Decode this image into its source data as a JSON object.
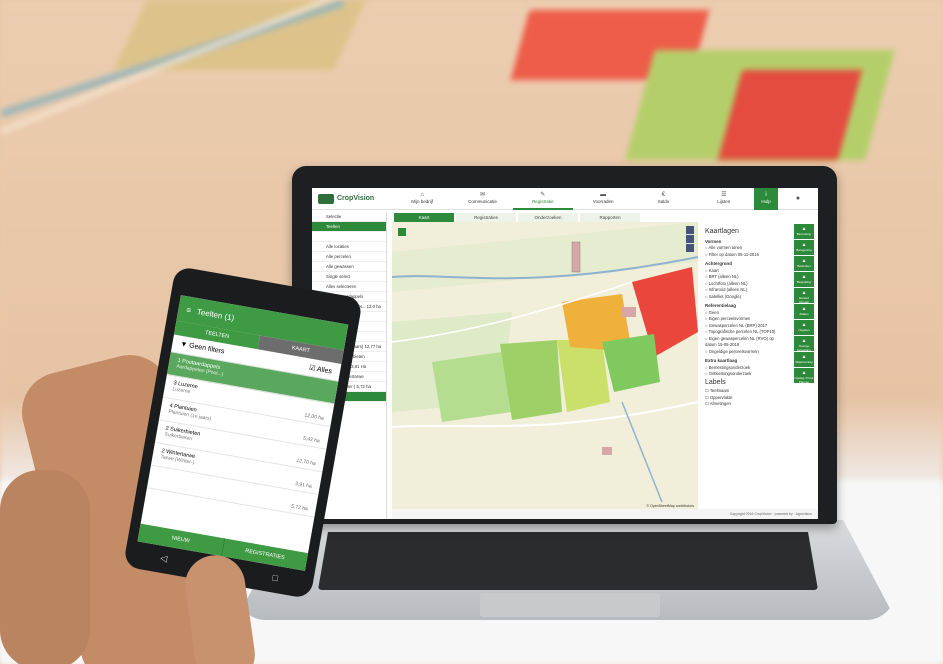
{
  "app": {
    "logo_text": "CropVision",
    "nav": [
      {
        "label": "Mijn bedrijf",
        "icon": "home-icon"
      },
      {
        "label": "Communicatie",
        "icon": "mail-icon"
      },
      {
        "label": "Registratie",
        "icon": "pencil-icon"
      },
      {
        "label": "Voorraden",
        "icon": "truck-icon"
      },
      {
        "label": "Saldo",
        "icon": "euro-icon"
      },
      {
        "label": "Lijsten",
        "icon": "list-icon"
      }
    ],
    "help_label": "Hulp",
    "sidebar": {
      "rows": [
        "Selectie",
        "Teelten",
        "",
        "Alle locaties",
        "Alle percelen",
        "Alle gewassen",
        "Single select",
        "Alles selecteren",
        "1 A Pootaardappels",
        "Aardappelen (Poot... 12,0 ha",
        "3 Luzerne",
        "Luzerne 5,42 ha",
        "4 Plantuien",
        "Plantuien (1e jaars) 12,77 ha",
        "Perc. 8 Suikerbieten",
        "Suikerbieten 3,91 Ha",
        "Perc. 5 Wintertarwe",
        "Tarwe (Winter-) 5,72 ha",
        "Teelt"
      ]
    },
    "tabs": [
      "Kaart",
      "Registraties",
      "Onderzoeken",
      "Rapporten"
    ],
    "panel": {
      "title": "Kaartlagen",
      "sections": [
        {
          "heading": "Vormen",
          "items": [
            "Alle vormen tonen",
            "Filter op datum 05-11-2016"
          ]
        },
        {
          "heading": "Achtergrond",
          "items": [
            "Kaart",
            "BRT (alleen NL)",
            "Luchtfoto (alleen NL)",
            "Infrarood (alleen NL)",
            "Satelliet (Google)"
          ]
        },
        {
          "heading": "Referentielaag",
          "items": [
            "Geen",
            "Eigen perceelsvormen",
            "Gewaspercelen NL (BRP) 2017",
            "Topografische percelen NL (TOP10)",
            "Eigen gewaspercelen NL (RVO) op datum 15-05-2019",
            "Ongeldige perceelsvormen"
          ]
        },
        {
          "heading": "Extra kaartlaag",
          "items": [
            "Bemestingsonderzoek",
            "Ontkiemingsonderzoek"
          ]
        }
      ],
      "labels_title": "Labels",
      "labels": [
        "Teeltnaam",
        "Oppervlakte",
        "Afmetingen"
      ]
    },
    "rail": [
      "Bemesting",
      "Beregening",
      "Bewerken",
      "Bespuiting",
      "Gereed (Oogst)",
      "Zaaien",
      "Oogsten",
      "Overige bewerking",
      "Waarneming",
      "Opslag / Prod. Planner"
    ],
    "map_attribution": "© OpenStreetMap contributors",
    "footer": "Copyright 2016 CropVision · powered by · Agrovision"
  },
  "phone": {
    "title": "Teelten (1)",
    "tabs": [
      "TEELTEN",
      "KAART"
    ],
    "filter_label": "Geen filters",
    "all_label": "Alles",
    "items": [
      {
        "name": "1 Pootaardappels",
        "crop": "Aardappelen (Poot...)",
        "area": "",
        "selected": true
      },
      {
        "name": "3 Luzerne",
        "crop": "Luzerne",
        "area": "12,00 ha",
        "selected": false
      },
      {
        "name": "4 Plantuien",
        "crop": "Plantuien (1e jaars)",
        "area": "5,42 ha",
        "selected": false
      },
      {
        "name": "2 Suikerbieten",
        "crop": "Suikerbieten",
        "area": "12,70 ha",
        "selected": false
      },
      {
        "name": "2 Wintertarwe",
        "crop": "Tarwe (Winter-)",
        "area": "3,91 ha",
        "selected": false
      },
      {
        "name": "",
        "crop": "",
        "area": "5,72 ha",
        "selected": false
      }
    ],
    "bottom_buttons": [
      "NIEUW",
      "REGISTRATIES"
    ]
  },
  "colors": {
    "brand_green": "#2d8a3a",
    "field_red": "#e8453c",
    "field_orange": "#f0a93b",
    "field_green": "#7cc95a"
  }
}
